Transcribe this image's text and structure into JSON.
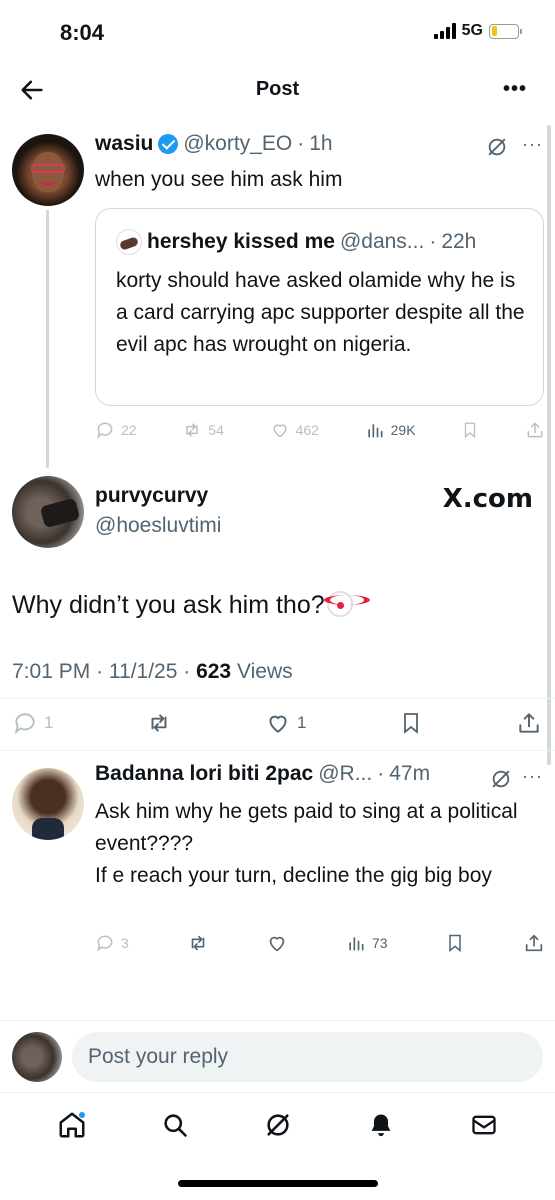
{
  "status_bar": {
    "time": "8:04",
    "network": "5G",
    "battery_level": 0.22
  },
  "header": {
    "title": "Post",
    "more": "•••"
  },
  "quoted_parent": {
    "name": "wasiu",
    "handle": "@korty_EO",
    "age": "1h",
    "text": "when you see him ask him",
    "quote": {
      "name": "hershey kissed me",
      "handle": "@dans...",
      "age": "22h",
      "text": "korty should have asked olamide why he is a card carrying apc supporter despite all the evil apc has wrought on nigeria."
    },
    "actions": {
      "replies": "22",
      "reposts": "54",
      "likes": "462",
      "views": "29K"
    }
  },
  "main_post": {
    "name": "purvycurvy",
    "handle": "@hoesluvtimi",
    "watermark": "X.com",
    "text": "Why didn’t you ask him tho?",
    "emoji": "clown-face",
    "time": "7:01 PM",
    "date": "11/1/25",
    "views": "623",
    "views_label": "Views",
    "actions": {
      "replies": "1",
      "likes": "1"
    }
  },
  "reply": {
    "name": "Badanna lori biti 2pac",
    "handle": "@R...",
    "age": "47m",
    "text_line1": "Ask him why he gets paid to sing at a political event????",
    "text_line2": "If e reach your turn, decline the gig big boy",
    "actions": {
      "replies": "3",
      "views": "73"
    }
  },
  "composer": {
    "placeholder": "Post your reply"
  },
  "colors": {
    "accent": "#1d9bf0",
    "text": "#0f1419",
    "secondary": "#536471",
    "border": "#cfd9de"
  }
}
